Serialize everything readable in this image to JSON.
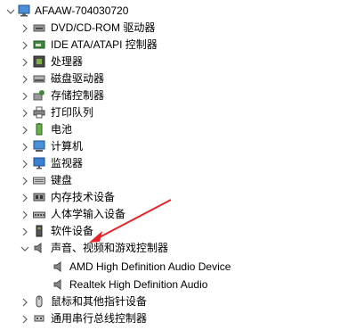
{
  "root": {
    "label": "AFAAW-704030720",
    "icon": "computer-icon"
  },
  "items": [
    {
      "label": "DVD/CD-ROM 驱动器",
      "icon": "dvd-drive-icon",
      "name": "tree-item-dvd-cdrom"
    },
    {
      "label": "IDE ATA/ATAPI 控制器",
      "icon": "ide-controller-icon",
      "name": "tree-item-ide-ata"
    },
    {
      "label": "处理器",
      "icon": "processor-icon",
      "name": "tree-item-processor"
    },
    {
      "label": "磁盘驱动器",
      "icon": "disk-drive-icon",
      "name": "tree-item-disk-drives"
    },
    {
      "label": "存储控制器",
      "icon": "storage-controller-icon",
      "name": "tree-item-storage-controllers"
    },
    {
      "label": "打印队列",
      "icon": "printer-icon",
      "name": "tree-item-print-queues"
    },
    {
      "label": "电池",
      "icon": "battery-icon",
      "name": "tree-item-batteries"
    },
    {
      "label": "计算机",
      "icon": "computer-icon",
      "name": "tree-item-computer"
    },
    {
      "label": "监视器",
      "icon": "monitor-icon",
      "name": "tree-item-monitors"
    },
    {
      "label": "键盘",
      "icon": "keyboard-icon",
      "name": "tree-item-keyboards"
    },
    {
      "label": "内存技术设备",
      "icon": "memory-device-icon",
      "name": "tree-item-memory-tech"
    },
    {
      "label": "人体学输入设备",
      "icon": "hid-icon",
      "name": "tree-item-hid"
    },
    {
      "label": "软件设备",
      "icon": "software-device-icon",
      "name": "tree-item-software-devices"
    },
    {
      "label": "声音、视频和游戏控制器",
      "icon": "speaker-icon",
      "name": "tree-item-sound-video-game",
      "expanded": true
    },
    {
      "label": "AMD High Definition Audio Device",
      "icon": "speaker-icon",
      "name": "tree-item-amd-hd-audio",
      "child": true
    },
    {
      "label": "Realtek High Definition Audio",
      "icon": "speaker-icon",
      "name": "tree-item-realtek-hd-audio",
      "child": true
    },
    {
      "label": "鼠标和其他指针设备",
      "icon": "mouse-icon",
      "name": "tree-item-mice"
    },
    {
      "label": "通用串行总线控制器",
      "icon": "usb-icon",
      "name": "tree-item-usb-controllers"
    }
  ],
  "colors": {
    "arrow": "#e8242a",
    "chevron": "#606060"
  }
}
